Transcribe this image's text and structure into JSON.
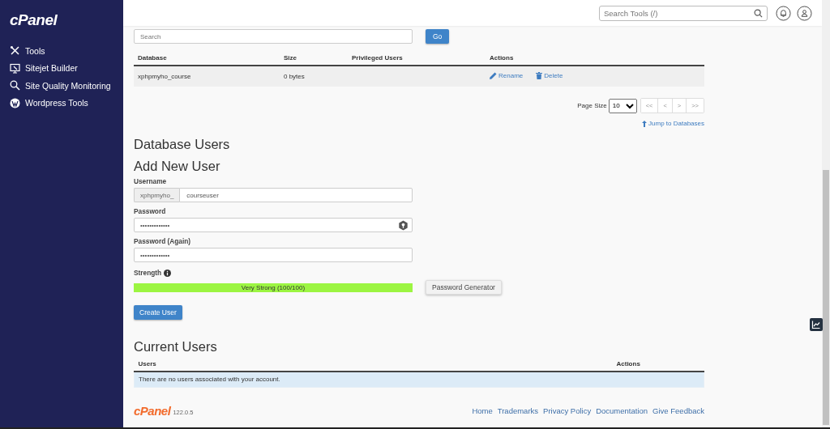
{
  "sidebar": {
    "logo": "cPanel",
    "items": [
      {
        "label": "Tools"
      },
      {
        "label": "Sitejet Builder"
      },
      {
        "label": "Site Quality Monitoring"
      },
      {
        "label": "Wordpress Tools"
      }
    ]
  },
  "header": {
    "search": {
      "placeholder": "Search Tools (/)"
    }
  },
  "databases": {
    "search": {
      "placeholder": "Search"
    },
    "go_button": "Go",
    "columns": [
      "Database",
      "Size",
      "Privileged Users",
      "Actions"
    ],
    "rows": [
      {
        "database": "xphpmyho_course",
        "size": "0 bytes",
        "privileged_users": "",
        "actions": [
          "Rename",
          "Delete"
        ]
      }
    ],
    "page_size_label": "Page Size",
    "page_size": "10",
    "pager": [
      "<<",
      "<",
      ">",
      ">>"
    ],
    "jump_link": "Jump to Databases"
  },
  "database_users": {
    "title": "Database Users",
    "add_title": "Add New User",
    "username": {
      "label": "Username",
      "prefix": "xphpmyho_",
      "value": "courseuser"
    },
    "password": {
      "label": "Password",
      "value": "•••••••••••••"
    },
    "password_again": {
      "label": "Password (Again)",
      "value": "•••••••••••••"
    },
    "strength": {
      "label": "Strength",
      "level": 1.0,
      "reading": "Very Strong (100/100)"
    },
    "generator_button": "Password Generator",
    "create_button": "Create User"
  },
  "current_users": {
    "title": "Current Users",
    "columns": [
      "Users",
      "Actions"
    ],
    "empty_message": "There are no users associated with your account."
  },
  "footer": {
    "logo": "cPanel",
    "version": "122.0.5",
    "links": [
      "Home",
      "Trademarks",
      "Privacy Policy",
      "Documentation",
      "Give Feedback"
    ]
  }
}
